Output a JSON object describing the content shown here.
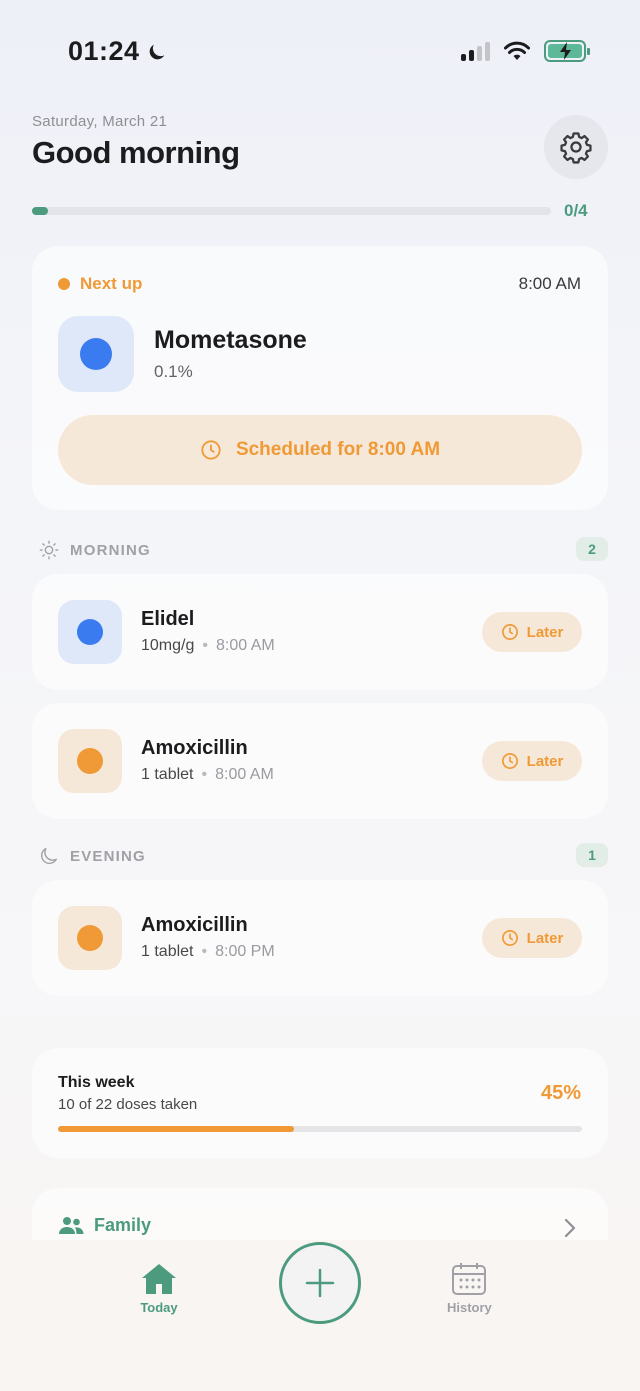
{
  "status_bar": {
    "time": "01:24"
  },
  "header": {
    "date": "Saturday, March 21",
    "greeting": "Good morning",
    "progress_label": "0/4",
    "progress_fraction": 0.03
  },
  "next_up": {
    "label": "Next up",
    "time": "8:00 AM",
    "med_name": "Mometasone",
    "med_dose": "0.1%",
    "scheduled_label": "Scheduled for 8:00 AM",
    "color": "#3b7bf0"
  },
  "sections": {
    "morning": {
      "title": "MORNING",
      "count": "2",
      "items": [
        {
          "name": "Elidel",
          "dose": "10mg/g",
          "time": "8:00 AM",
          "action": "Later",
          "color": "#3b7bf0"
        },
        {
          "name": "Amoxicillin",
          "dose": "1 tablet",
          "time": "8:00 AM",
          "action": "Later",
          "color": "#ef9a36"
        }
      ]
    },
    "evening": {
      "title": "EVENING",
      "count": "1",
      "items": [
        {
          "name": "Amoxicillin",
          "dose": "1 tablet",
          "time": "8:00 PM",
          "action": "Later",
          "color": "#ef9a36"
        }
      ]
    }
  },
  "separator": "•",
  "week": {
    "title": "This week",
    "subtitle": "10 of 22 doses taken",
    "percent": "45%",
    "fraction": 0.45
  },
  "family": {
    "label": "Family"
  },
  "tab_bar": {
    "today": "Today",
    "history": "History"
  },
  "colors": {
    "accent_green": "#4c9b7f",
    "accent_orange": "#ef9a36",
    "blue": "#3b7bf0"
  },
  "icons": {
    "settings": "gear-icon",
    "scheduled": "clock-icon",
    "morning": "sun-icon",
    "evening": "moon-icon",
    "family": "people-icon",
    "today": "home-icon",
    "add": "plus-icon",
    "history": "calendar-icon"
  }
}
